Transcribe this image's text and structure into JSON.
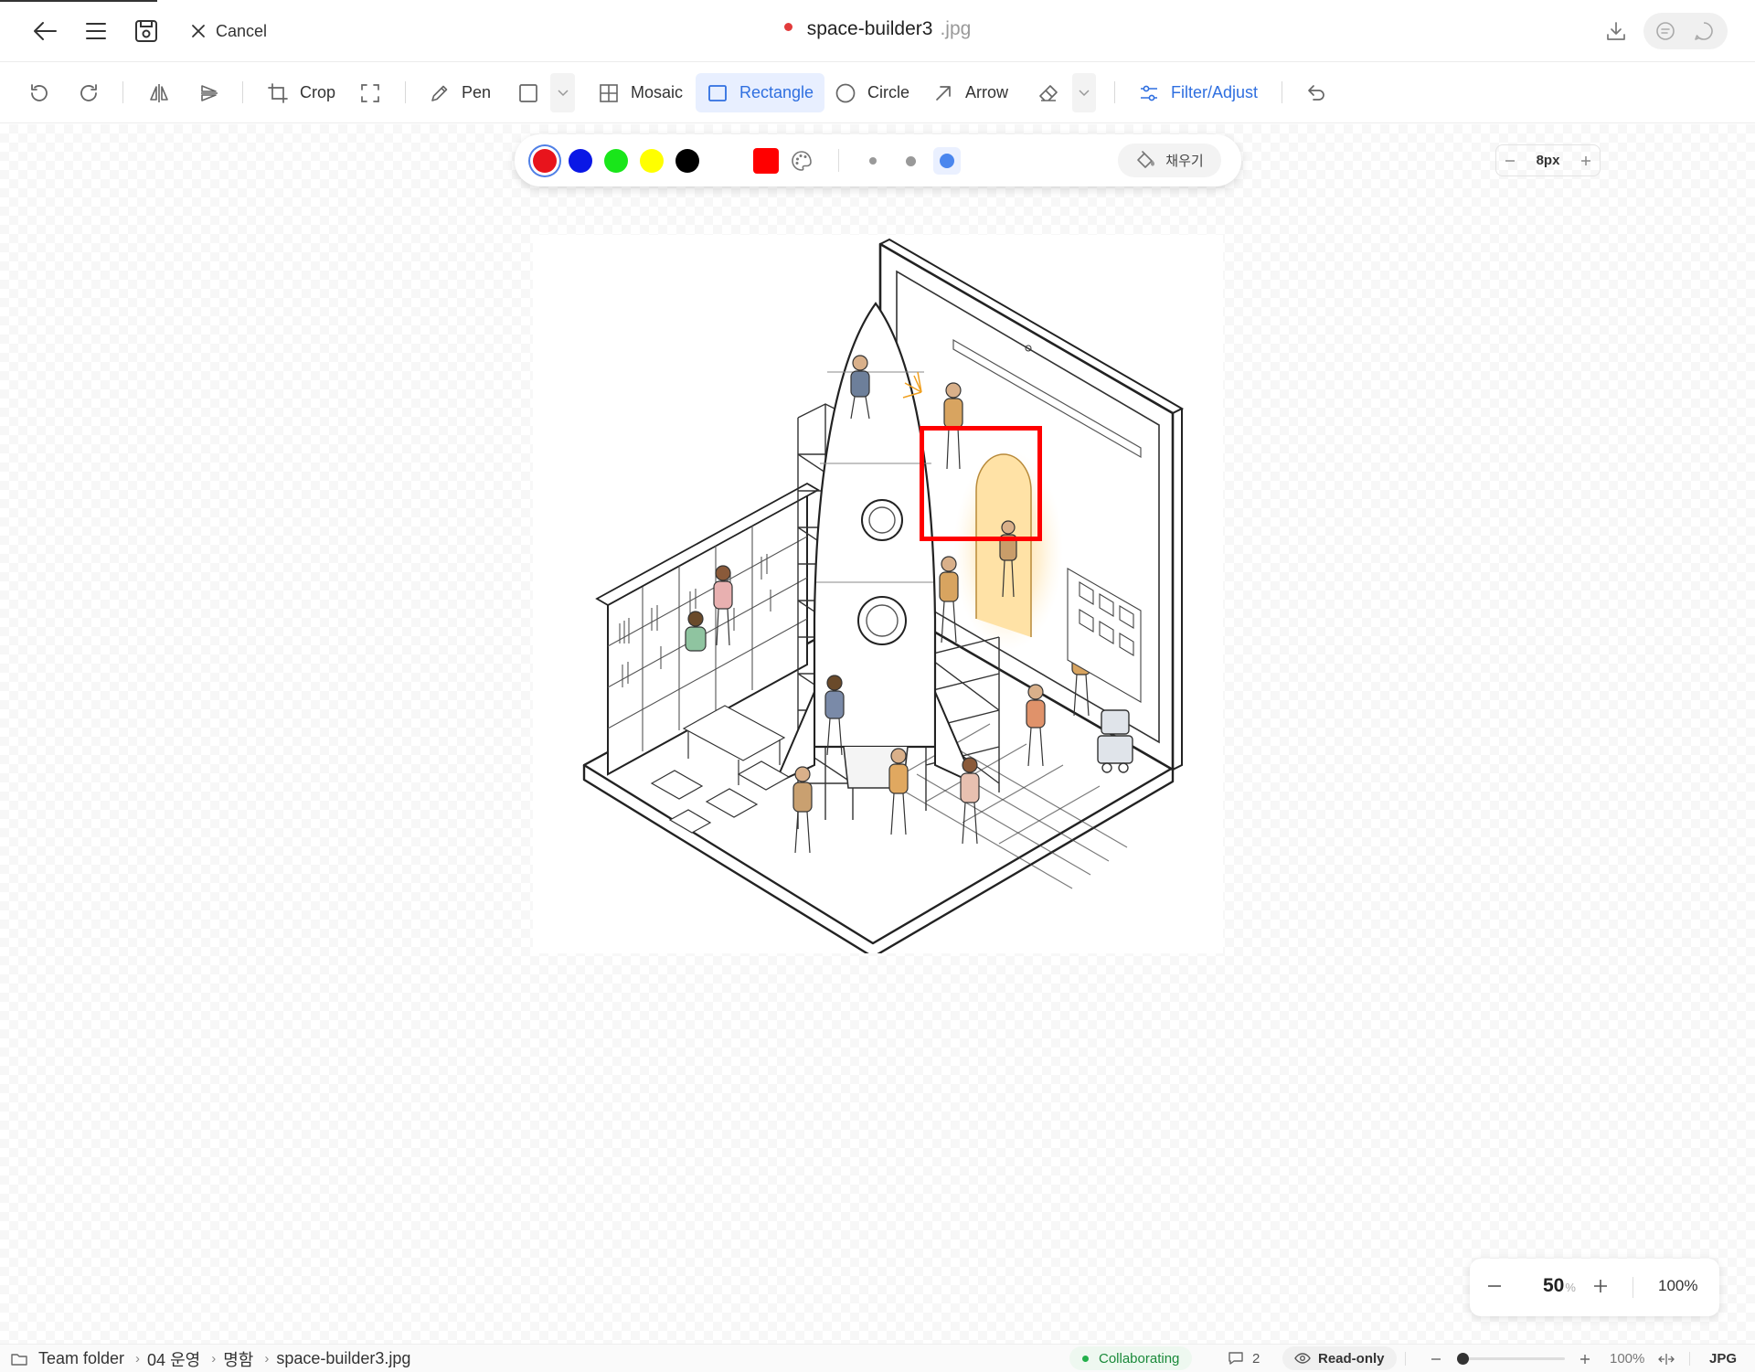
{
  "header": {
    "cancel_label": "Cancel",
    "file_name": "space-builder3",
    "file_ext": ".jpg",
    "unsaved_indicator_color": "#e23b3b"
  },
  "toolbar": {
    "crop_label": "Crop",
    "pen_label": "Pen",
    "mosaic_label": "Mosaic",
    "rectangle_label": "Rectangle",
    "circle_label": "Circle",
    "arrow_label": "Arrow",
    "filter_label": "Filter/Adjust",
    "active_tool": "Rectangle",
    "accent_color": "#2f6fe0"
  },
  "palette": {
    "colors": [
      "#e8141c",
      "#0a17e6",
      "#19e61a",
      "#ffff00",
      "#000000"
    ],
    "selected_color": "#e8141c",
    "current_color": "#ff0000",
    "stroke_size": "8px",
    "fill_label": "채우기"
  },
  "zoom": {
    "level": "50",
    "unit": "%",
    "reset_label": "100%"
  },
  "statusbar": {
    "breadcrumb": [
      "Team folder",
      "04 운영",
      "명함",
      "space-builder3.jpg"
    ],
    "collab_label": "Collaborating",
    "comment_count": "2",
    "readonly_label": "Read-only",
    "zoom_value": "100%",
    "format": "JPG"
  }
}
